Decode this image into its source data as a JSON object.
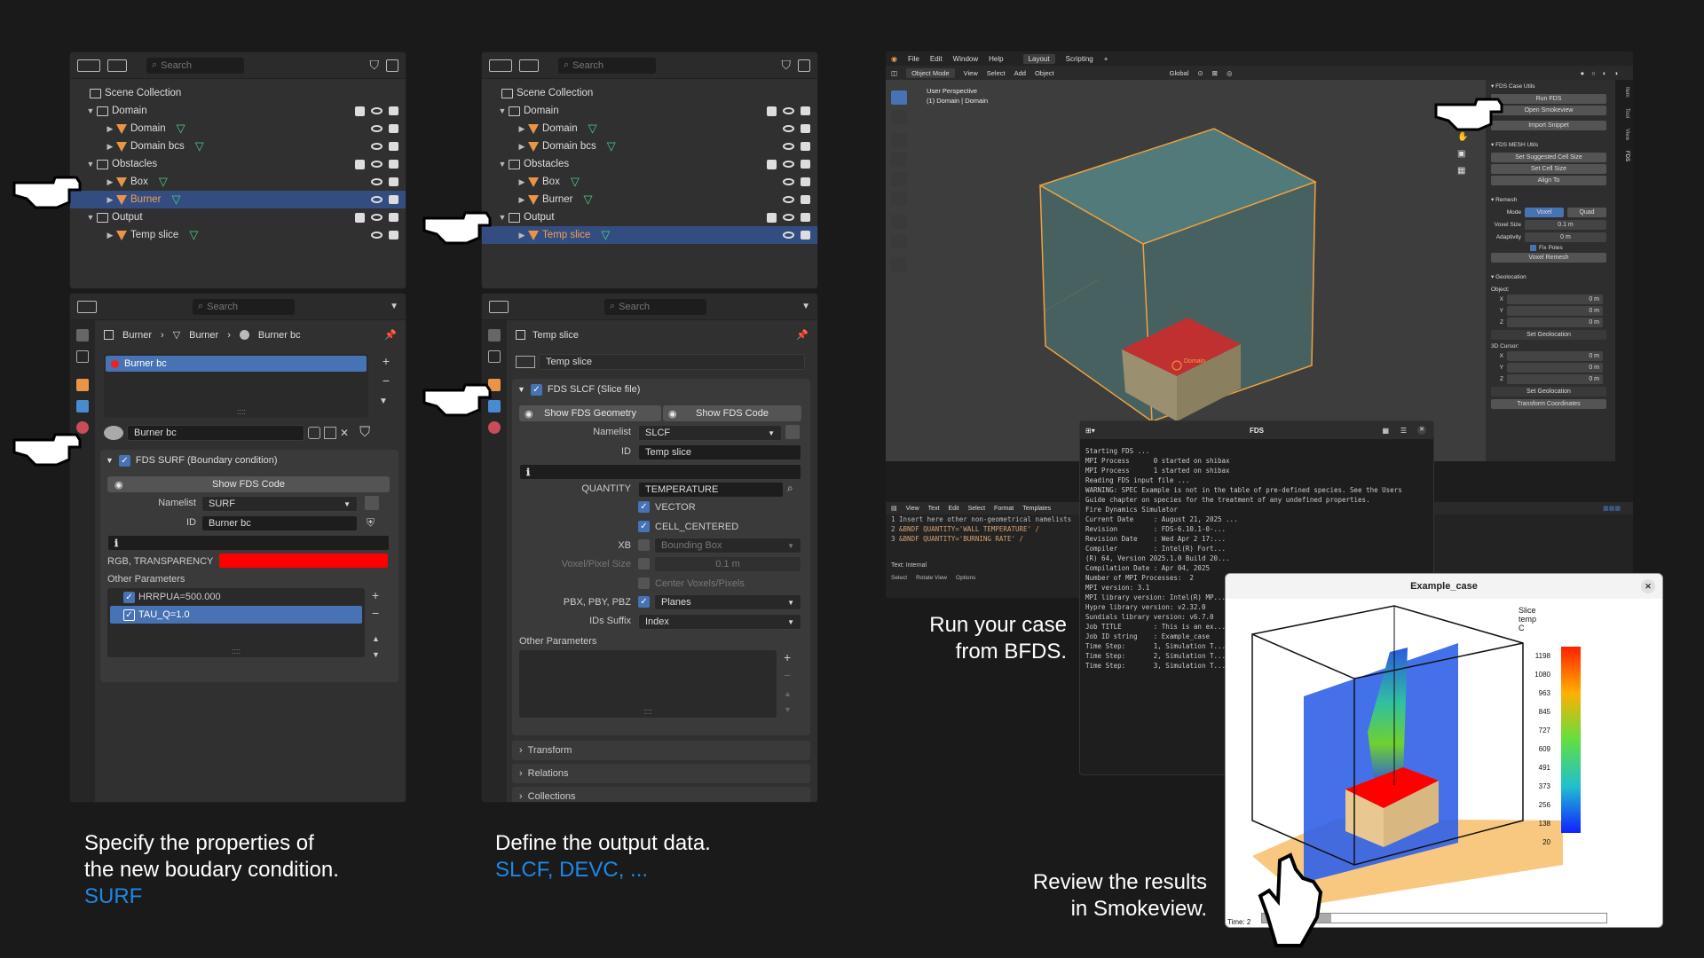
{
  "outliner": {
    "search_placeholder": "Search",
    "scene_collection": "Scene Collection",
    "domain": "Domain",
    "domain_obj": "Domain",
    "domain_bcs": "Domain bcs",
    "obstacles": "Obstacles",
    "box": "Box",
    "burner": "Burner",
    "output": "Output",
    "temp_slice": "Temp slice"
  },
  "props_surf": {
    "search_placeholder": "Search",
    "breadcrumb_1": "Burner",
    "breadcrumb_2": "Burner",
    "breadcrumb_3": "Burner bc",
    "material_item": "Burner bc",
    "material_name": "Burner bc",
    "panel_title": "FDS SURF (Boundary condition)",
    "show_code": "Show FDS Code",
    "namelist_label": "Namelist",
    "namelist_value": "SURF",
    "id_label": "ID",
    "id_value": "Burner bc",
    "rgb_label": "RGB, TRANSPARENCY",
    "other_params": "Other Parameters",
    "param_1": "HRRPUA=500.000",
    "param_2": "TAU_Q=1.0",
    "color": "#ff0000"
  },
  "props_slcf": {
    "search_placeholder": "Search",
    "breadcrumb": "Temp slice",
    "object_name": "Temp slice",
    "panel_title": "FDS SLCF (Slice file)",
    "show_geometry": "Show FDS Geometry",
    "show_code": "Show FDS Code",
    "namelist_label": "Namelist",
    "namelist_value": "SLCF",
    "id_label": "ID",
    "id_value": "Temp slice",
    "quantity_label": "QUANTITY",
    "quantity_value": "TEMPERATURE",
    "vector": "VECTOR",
    "cell_centered": "CELL_CENTERED",
    "xb_label": "XB",
    "xb_value": "Bounding Box",
    "voxel_label": "Voxel/Pixel Size",
    "voxel_value": "0.1 m",
    "center_voxels": "Center Voxels/Pixels",
    "pb_label": "PBX, PBY, PBZ",
    "pb_value": "Planes",
    "ids_label": "IDs Suffix",
    "ids_value": "Index",
    "other_params": "Other Parameters",
    "transform": "Transform",
    "relations": "Relations",
    "collections": "Collections"
  },
  "blender": {
    "menu": [
      "File",
      "Edit",
      "Window",
      "Help"
    ],
    "tabs": [
      "Layout",
      "Scripting"
    ],
    "mode": "Object Mode",
    "view_menu": [
      "View",
      "Select",
      "Add",
      "Object"
    ],
    "transform": "Global",
    "viewport_title": "User Perspective",
    "viewport_sub": "(1) Domain | Domain",
    "domain_label": "Domain",
    "case_utils": "FDS Case Utils",
    "run_fds": "Run FDS",
    "open_smokeview": "Open Smokeview",
    "import_snippet": "Import Snippet",
    "mesh_utils": "FDS MESH Utils",
    "set_suggested": "Set Suggested Cell Size",
    "set_cell": "Set Cell Size",
    "align_to": "Align To",
    "remesh": "Remesh",
    "mode_label": "Mode",
    "voxel": "Voxel",
    "quad": "Quad",
    "voxel_size_label": "Voxel Size",
    "voxel_size": "0.1 m",
    "adaptivity_label": "Adaptivity",
    "adaptivity": "0 m",
    "fix_poles": "Fix Poles",
    "voxel_remesh": "Voxel Remesh",
    "geolocation": "Geolocation",
    "object_label": "Object:",
    "x": "X",
    "y": "Y",
    "z": "Z",
    "zero": "0 m",
    "set_geolocation": "Set Geolocation",
    "cursor_label": "3D Cursor:",
    "transform_coords": "Transform Coordinates",
    "side_tabs": [
      "Item",
      "Tool",
      "View",
      "FDS"
    ],
    "text_menu": [
      "View",
      "Text",
      "Edit",
      "Select",
      "Format",
      "Templates"
    ],
    "text_lines": [
      "Insert here other non-geometrical namelists",
      "&BNDF QUANTITY='WALL TEMPERATURE' /",
      "&BNDF QUANTITY='BURNING RATE' /"
    ],
    "text_status": "Text: Internal",
    "status_items": [
      "Select",
      "Rotate View",
      "Options"
    ]
  },
  "fds_terminal": {
    "title": "FDS",
    "lines": [
      "Starting FDS ...",
      "",
      "MPI Process      0 started on shibax",
      "MPI Process      1 started on shibax",
      "",
      "Reading FDS input file ...",
      "",
      "WARNING: SPEC Example is not in the table of pre-defined species. See the Users",
      "Guide chapter on species for the treatment of any undefined properties.",
      "",
      "Fire Dynamics Simulator",
      "",
      "Current Date     : August 21, 2025 ...",
      "Revision         : FDS-6.10.1-0-...",
      "Revision Date    : Wed Apr 2 17:...",
      "Compiler         : Intel(R) Fort...",
      "(R) 64, Version 2025.1.0 Build 20...",
      "Compilation Date : Apr 04, 2025",
      "",
      "Number of MPI Processes:  2",
      "",
      "MPI version: 3.1",
      "MPI library version: Intel(R) MP...",
      "",
      "Hypre library version: v2.32.0",
      "Sundials library version: v6.7.0",
      "",
      "Job TITLE        : This is an ex...",
      "Job ID string    : Example_case",
      "",
      "Time Step:       1, Simulation T...",
      "Time Step:       2, Simulation T...",
      "Time Step:       3, Simulation T..."
    ]
  },
  "smokeview": {
    "title": "Example_case",
    "legend_title": [
      "Slice",
      "temp",
      "C"
    ],
    "legend_values": [
      "1198",
      "1080",
      "963",
      "845",
      "727",
      "609",
      "491",
      "373",
      "256",
      "138",
      "20"
    ],
    "time_label": "Time: 2"
  },
  "captions": {
    "c1_line1": "Specify the properties of",
    "c1_line2": "the new boudary condition.",
    "c1_line3": "SURF",
    "c2_line1": "Define the output data.",
    "c2_line2": "SLCF, DEVC, ...",
    "c3_line1": "Run your case",
    "c3_line2": "from BFDS.",
    "c4_line1": "Review the results",
    "c4_line2": "in Smokeview."
  },
  "colors": {
    "selection": "#334d80",
    "accent": "#4772b3",
    "caption_blue": "#1e88e5",
    "object_orange": "#e8954a"
  }
}
